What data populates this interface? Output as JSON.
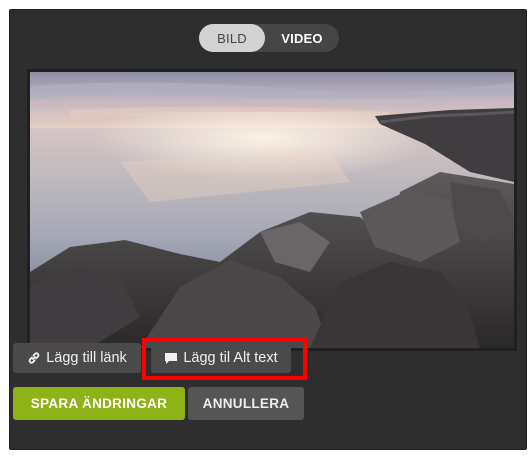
{
  "toggle": {
    "image_label": "BILD",
    "video_label": "VIDEO",
    "selected": "BILD"
  },
  "media": {
    "image_alt": "Rocky breakwater at sunset by the sea"
  },
  "actions": {
    "add_link_label": "Lägg till länk",
    "add_alt_label": "Lägg til Alt text",
    "save_label": "SPARA ÄNDRINGAR",
    "cancel_label": "ANNULLERA"
  },
  "colors": {
    "panel_bg": "#2e2e2e",
    "save_accent": "#8db316",
    "highlight": "#ff0000"
  },
  "icons": {
    "link": "link-icon",
    "alt": "speech-bubble-icon"
  }
}
